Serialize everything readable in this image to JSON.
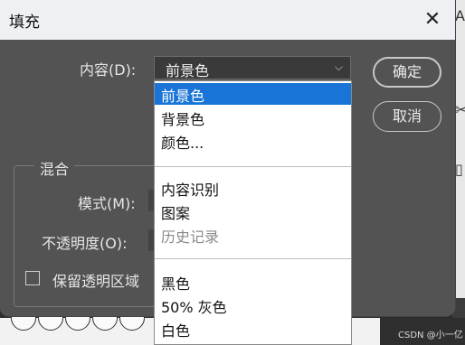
{
  "dialog": {
    "title": "填充",
    "content_label": "内容(D):",
    "content_value": "前景色",
    "ok_label": "确定",
    "cancel_label": "取消",
    "blend_group_title": "混合",
    "mode_label": "模式(M):",
    "opacity_label": "不透明度(O):",
    "preserve_label": "保留透明区域"
  },
  "dropdown": {
    "items": [
      {
        "label": "前景色",
        "state": "selected"
      },
      {
        "label": "背景色",
        "state": "normal"
      },
      {
        "label": "颜色...",
        "state": "normal"
      },
      {
        "label": "内容识别",
        "state": "normal"
      },
      {
        "label": "图案",
        "state": "normal"
      },
      {
        "label": "历史记录",
        "state": "disabled"
      },
      {
        "label": "黑色",
        "state": "normal"
      },
      {
        "label": "50% 灰色",
        "state": "normal"
      },
      {
        "label": "白色",
        "state": "normal"
      }
    ]
  },
  "watermark": "CSDN @小一亿",
  "colors": {
    "accent": "#1874d6",
    "dialog_bg": "#535353",
    "titlebar_bg": "#eef0f4"
  }
}
